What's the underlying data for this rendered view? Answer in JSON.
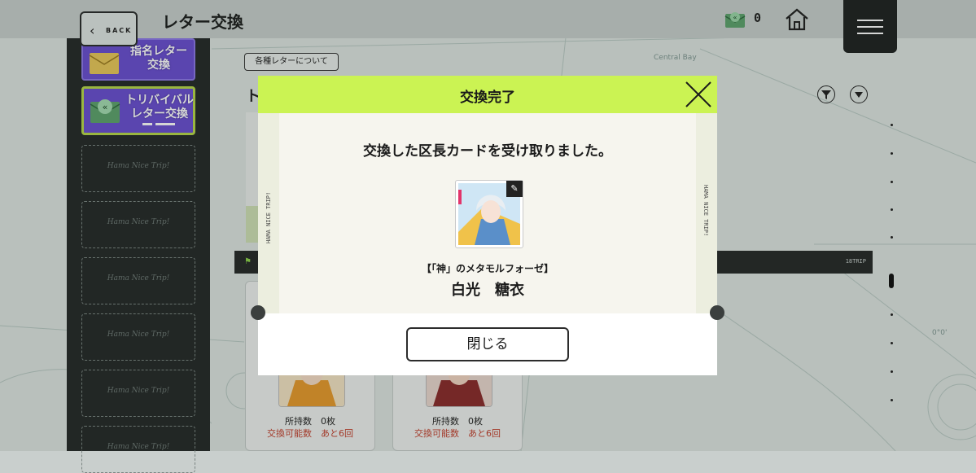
{
  "header": {
    "back_label": "BACK",
    "title": "レター交換",
    "letter_count": "0"
  },
  "sidebar": {
    "items": [
      {
        "label_line1": "指名レター",
        "label_line2": "交換"
      },
      {
        "label_line1": "トリバイバル",
        "label_line2": "レター交換"
      }
    ],
    "empty_slot_text": "Hama Nice Trip!"
  },
  "main": {
    "about_button": "各種レターについて",
    "heading_initial": "ト",
    "progress_label": "18TRIP",
    "cards": [
      {
        "owned_label": "所持数",
        "owned_value": "0枚",
        "exchange_label": "交換可能数",
        "exchange_value": "あと6回"
      },
      {
        "owned_label": "所持数",
        "owned_value": "0枚",
        "exchange_label": "交換可能数",
        "exchange_value": "あと6回"
      }
    ]
  },
  "map_labels": {
    "bay": "Central Bay",
    "angle": "0°0'"
  },
  "modal": {
    "title": "交換完了",
    "message": "交換した区長カードを受け取りました。",
    "stub_text": "HAMA NICE TRIP!",
    "card_subtitle": "【「神」のメタモルフォーゼ】",
    "card_name": "白光　糖衣",
    "close_button": "閉じる"
  },
  "colors": {
    "accent_green": "#cbf353",
    "sidebar_purple": "#6a4fd1",
    "exchange_red": "#c2412f"
  },
  "icons": [
    "back-chevron-icon",
    "letter-icon",
    "home-icon",
    "menu-icon",
    "filter-icon",
    "sort-icon",
    "close-icon",
    "flag-icon"
  ]
}
